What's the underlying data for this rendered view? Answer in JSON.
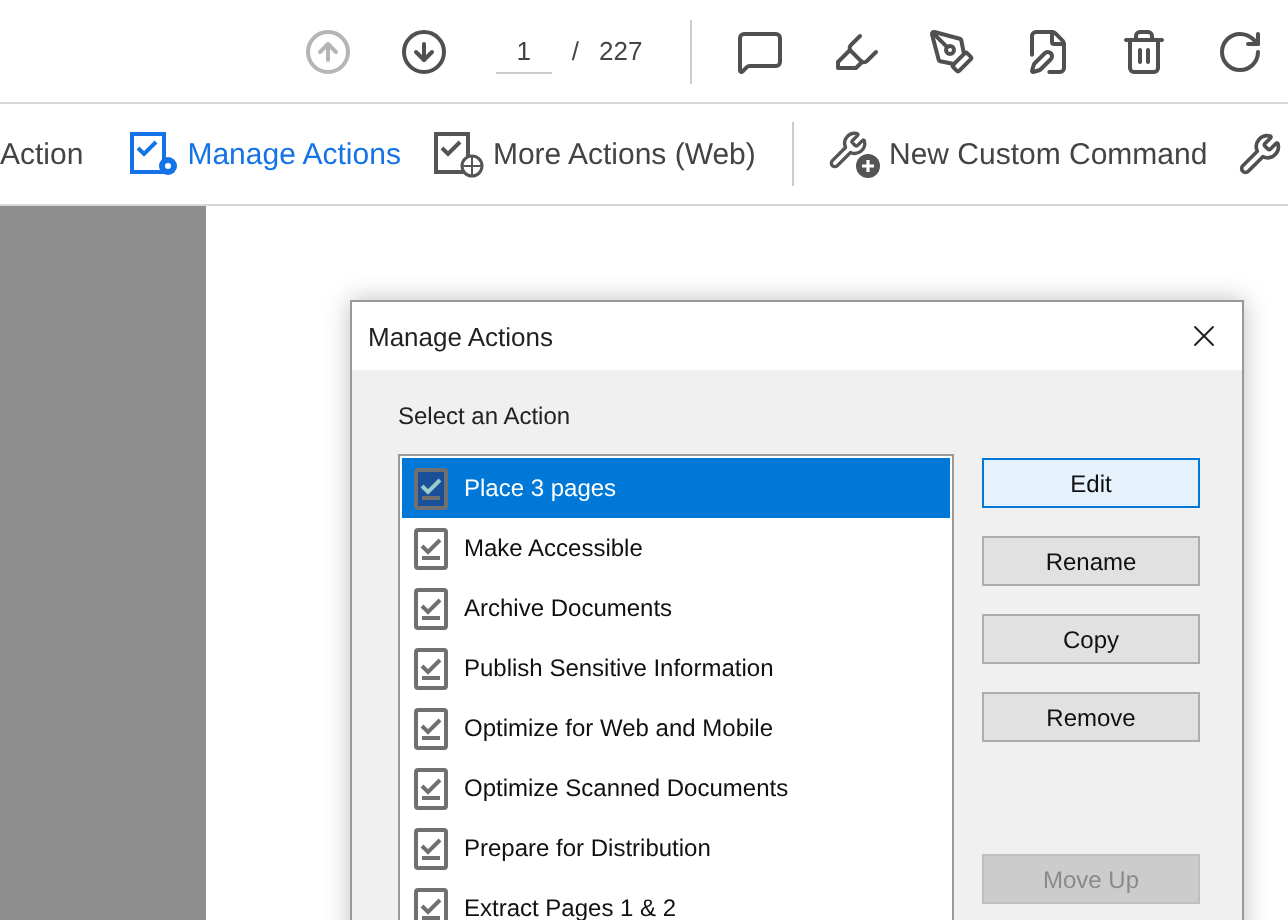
{
  "top_toolbar": {
    "page_field": {
      "value": "1"
    },
    "page_separator": "/",
    "page_total": "227",
    "prev_disabled": true
  },
  "actions_toolbar": {
    "items": [
      {
        "kind": "cut",
        "label": "Action",
        "selected": false
      },
      {
        "kind": "manage",
        "label": "Manage Actions",
        "selected": true
      },
      {
        "kind": "web",
        "label": "More Actions (Web)",
        "selected": false
      },
      {
        "kind": "custom",
        "label": "New Custom Command",
        "selected": false
      }
    ]
  },
  "dialog": {
    "title": "Manage Actions",
    "list_label": "Select an Action",
    "actions": [
      {
        "label": "Place 3 pages",
        "selected": true
      },
      {
        "label": "Make Accessible",
        "selected": false
      },
      {
        "label": "Archive Documents",
        "selected": false
      },
      {
        "label": "Publish Sensitive Information",
        "selected": false
      },
      {
        "label": "Optimize for Web and Mobile",
        "selected": false
      },
      {
        "label": "Optimize Scanned Documents",
        "selected": false
      },
      {
        "label": "Prepare for Distribution",
        "selected": false
      },
      {
        "label": "Extract Pages 1 & 2",
        "selected": false
      }
    ],
    "buttons": [
      {
        "label": "Edit",
        "disabled": false,
        "focused": true
      },
      {
        "label": "Rename",
        "disabled": false,
        "focused": false
      },
      {
        "label": "Copy",
        "disabled": false,
        "focused": false
      },
      {
        "label": "Remove",
        "disabled": false,
        "focused": false
      },
      {
        "label": "Move Up",
        "disabled": true,
        "focused": false
      }
    ]
  }
}
